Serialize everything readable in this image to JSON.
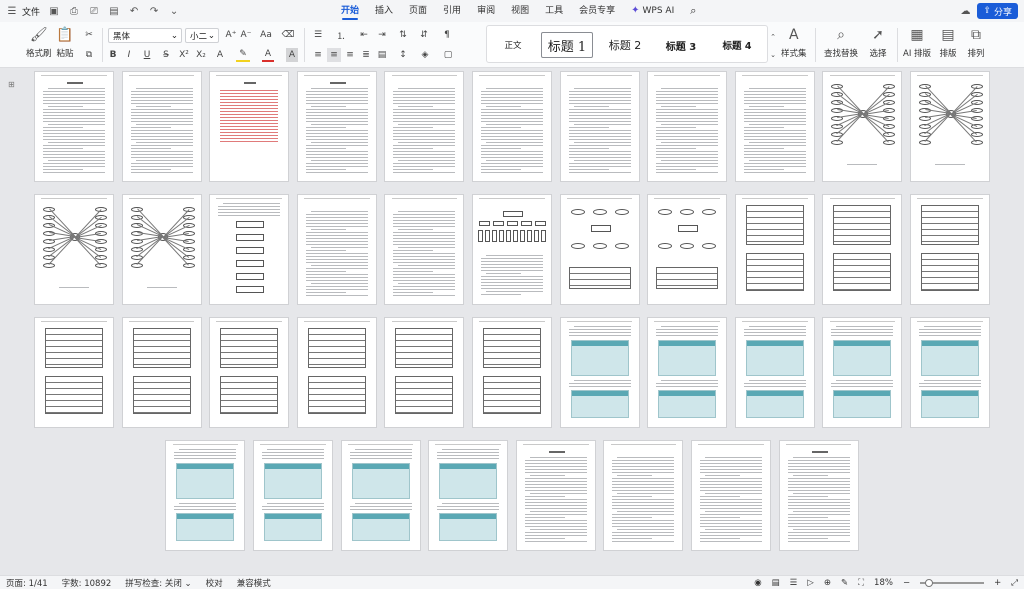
{
  "menubar": {
    "file_label": "文件",
    "tabs": [
      "开始",
      "插入",
      "页面",
      "引用",
      "审阅",
      "视图",
      "工具",
      "会员专享"
    ],
    "active_tab": "开始",
    "wps_ai_label": "WPS AI",
    "share_label": "分享",
    "accent_color": "#1a5cd8"
  },
  "ribbon": {
    "format_painter_label": "格式刷",
    "paste_label": "粘贴",
    "font_name": "黑体",
    "font_size": "小二",
    "styles": {
      "normal": "正文",
      "heading1": "标题 1",
      "heading2": "标题 2",
      "heading3": "标题 3",
      "heading4": "标题 4"
    },
    "style_set_label": "样式集",
    "find_replace_label": "查找替换",
    "select_label": "选择",
    "ai_layout_label": "AI 排版",
    "layout_label": "排版",
    "arrange_label": "排列"
  },
  "status": {
    "page": "页面: 1/41",
    "word_count": "字数: 10892",
    "spell_check": "拼写检查: 关闭",
    "proofread": "校对",
    "compat_mode": "兼容模式",
    "zoom": "18%"
  },
  "document": {
    "rows": [
      11,
      11,
      11,
      8
    ],
    "page_kinds": [
      "text",
      "text",
      "toc",
      "text",
      "text",
      "text",
      "text",
      "text",
      "text",
      "diagram-star",
      "diagram-star",
      "diagram-star",
      "diagram-star",
      "flowchart",
      "text",
      "text",
      "tree",
      "er",
      "er",
      "table",
      "table",
      "table",
      "table",
      "table",
      "table",
      "table",
      "table",
      "table",
      "screens",
      "screens",
      "screens",
      "screens",
      "screens",
      "screens",
      "screens",
      "screens",
      "screens",
      "text",
      "text",
      "text",
      "text"
    ]
  }
}
